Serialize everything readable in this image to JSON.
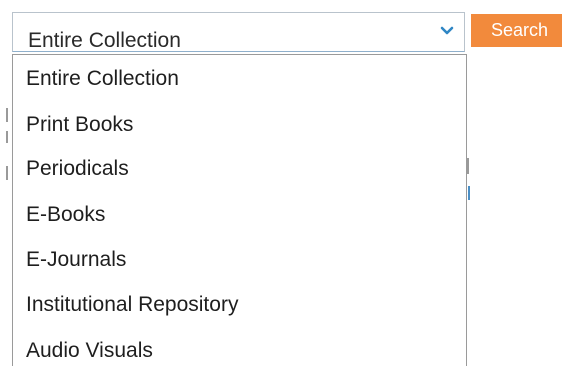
{
  "search": {
    "selected_value": "Entire Collection",
    "button_label": "Search"
  },
  "dropdown": {
    "options": [
      "Entire Collection",
      "Print Books",
      "Periodicals",
      "E-Books",
      "E-Journals",
      "Institutional Repository",
      "Audio Visuals"
    ]
  },
  "colors": {
    "button_bg": "#f28a3c",
    "chevron": "#2f86c4",
    "select_border": "#b9c3cc"
  },
  "icons": {
    "chevron": "chevron-down-icon"
  }
}
